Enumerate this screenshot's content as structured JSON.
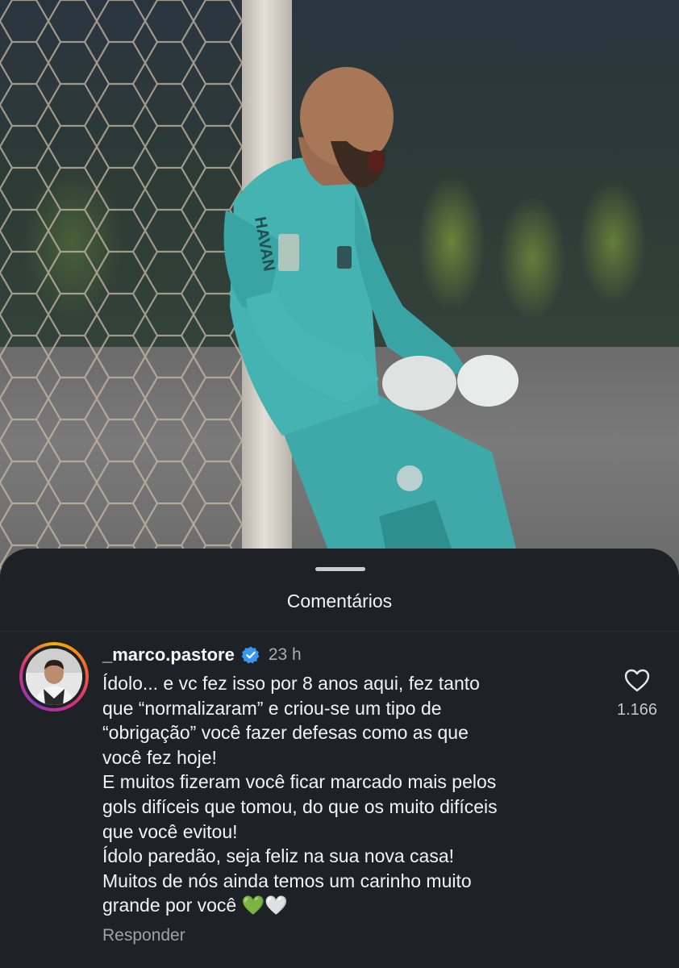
{
  "sheet": {
    "title": "Comentários"
  },
  "comment": {
    "username": "_marco.pastore",
    "verified": true,
    "time": "23 h",
    "text": "Ídolo... e vc fez isso por 8 anos aqui, fez tanto\nque “normalizaram” e criou-se um tipo de\n“obrigação” você fazer defesas como as que\nvocê fez hoje!\nE muitos fizeram você ficar marcado mais pelos\ngols difíceis que tomou, do que os muito difíceis\nque você evitou!\nÍdolo paredão, seja feliz na sua nova casa!\nMuitos de nós ainda temos um carinho muito\ngrande por você 💚🤍",
    "reply_label": "Responder",
    "like_count": "1.166",
    "like_icon": "heart-outline-icon"
  },
  "photo": {
    "jersey_sponsor": "HAVAN"
  },
  "colors": {
    "sheet_bg": "#1e2226",
    "verified_blue": "#3897f0"
  }
}
